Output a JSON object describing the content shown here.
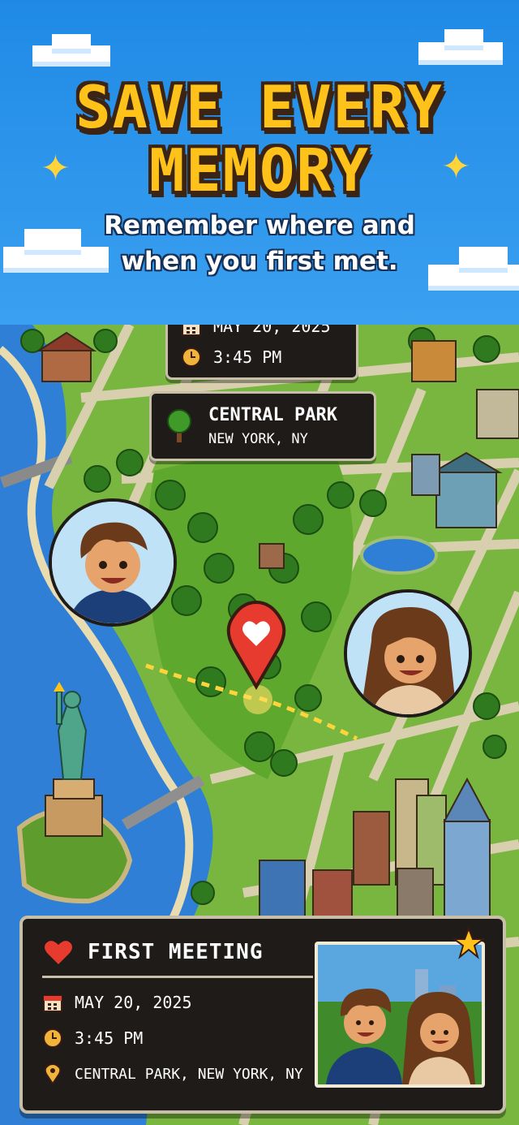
{
  "hero": {
    "headline_line1": "SAVE EVERY",
    "headline_line2": "MEMORY",
    "subtitle_line1": "Remember where and",
    "subtitle_line2": "when you first met."
  },
  "map_tags": {
    "date": "MAY 20, 2025",
    "time": "3:45 PM",
    "place_name": "CENTRAL PARK",
    "place_city": "NEW YORK, NY"
  },
  "memory_card": {
    "title": "FIRST MEETING",
    "date": "MAY 20, 2025",
    "time": "3:45 PM",
    "location": "CENTRAL PARK, NEW YORK, NY"
  },
  "icons": {
    "calendar": "calendar-icon",
    "clock": "clock-icon",
    "tree": "tree-icon",
    "heart": "heart-icon",
    "pin": "location-pin-icon",
    "star": "star-icon"
  },
  "colors": {
    "sky": "#1f8ae6",
    "headline": "#ffc21a",
    "panel": "#1e1b19",
    "panel_border": "#c7bfa8",
    "heart": "#e63b2e",
    "water": "#2f7fd6",
    "park": "#5fa82e"
  }
}
